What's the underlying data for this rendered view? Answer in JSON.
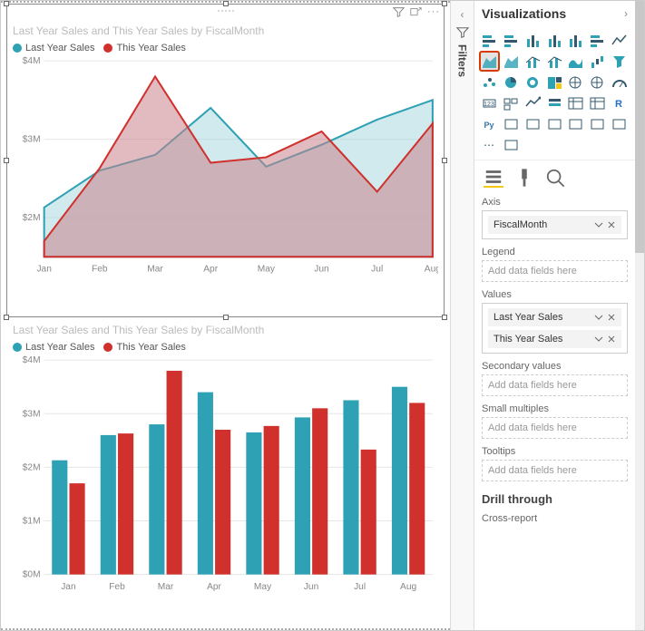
{
  "panels": {
    "visualizations_title": "Visualizations",
    "filters_label": "Filters",
    "drill_label": "Drill through",
    "cross_report_label": "Cross-report"
  },
  "wells": {
    "axis_label": "Axis",
    "axis_item": "FiscalMonth",
    "legend_label": "Legend",
    "values_label": "Values",
    "value1": "Last Year Sales",
    "value2": "This Year Sales",
    "secondary_label": "Secondary values",
    "small_mult_label": "Small multiples",
    "tooltips_label": "Tooltips",
    "placeholder": "Add data fields here"
  },
  "chart_title": "Last Year Sales and This Year Sales by FiscalMonth",
  "legend": {
    "s1": "Last Year Sales",
    "s2": "This Year Sales"
  },
  "colors": {
    "s1": "#2ea1b4",
    "s2": "#d0312d",
    "s1_fill": "#a9d8df",
    "s2_fill": "#c8848c"
  },
  "chart_data": [
    {
      "type": "area",
      "title": "Last Year Sales and This Year Sales by FiscalMonth",
      "categories": [
        "Jan",
        "Feb",
        "Mar",
        "Apr",
        "May",
        "Jun",
        "Jul",
        "Aug"
      ],
      "series": [
        {
          "name": "Last Year Sales",
          "values": [
            2.13,
            2.6,
            2.8,
            3.4,
            2.65,
            2.93,
            3.25,
            3.5
          ]
        },
        {
          "name": "This Year Sales",
          "values": [
            1.7,
            2.63,
            3.8,
            2.7,
            2.77,
            3.1,
            2.33,
            3.2
          ]
        }
      ],
      "ylabel": "",
      "xlabel": "",
      "ylim": [
        1.5,
        4.0
      ],
      "yticks": [
        "$4M",
        "$3M",
        "$2M"
      ],
      "yprefix": "$",
      "ysuffix": "M"
    },
    {
      "type": "bar",
      "title": "Last Year Sales and This Year Sales by FiscalMonth",
      "categories": [
        "Jan",
        "Feb",
        "Mar",
        "Apr",
        "May",
        "Jun",
        "Jul",
        "Aug"
      ],
      "series": [
        {
          "name": "Last Year Sales",
          "values": [
            2.13,
            2.6,
            2.8,
            3.4,
            2.65,
            2.93,
            3.25,
            3.5
          ]
        },
        {
          "name": "This Year Sales",
          "values": [
            1.7,
            2.63,
            3.8,
            2.7,
            2.77,
            3.1,
            2.33,
            3.2
          ]
        }
      ],
      "ylabel": "",
      "xlabel": "",
      "ylim": [
        0,
        4.0
      ],
      "yticks": [
        "$4M",
        "$3M",
        "$2M",
        "$1M",
        "$0M"
      ],
      "yprefix": "$",
      "ysuffix": "M"
    }
  ]
}
